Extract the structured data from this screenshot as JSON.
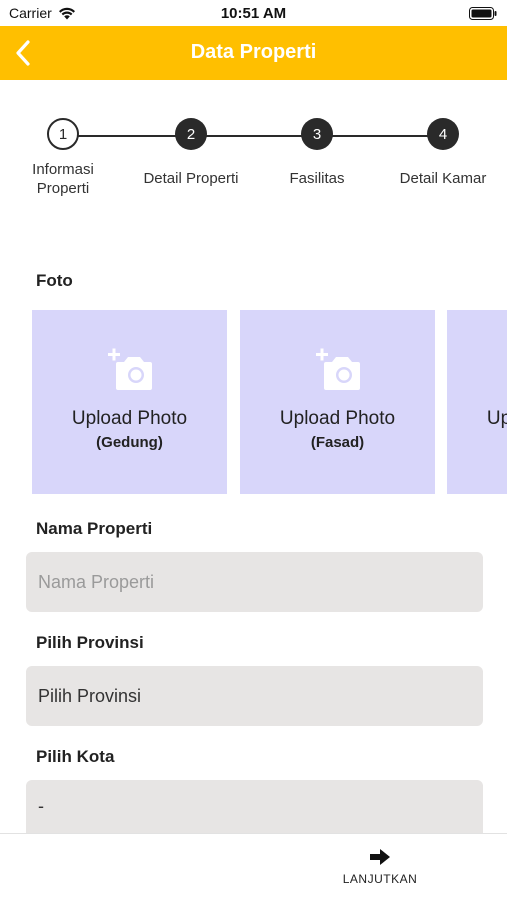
{
  "status_bar": {
    "carrier": "Carrier",
    "time": "10:51 AM"
  },
  "header": {
    "title": "Data Properti",
    "back_icon": "chevron-left-icon"
  },
  "stepper": {
    "steps": [
      {
        "number": "1",
        "label": "Informasi Properti",
        "active": true
      },
      {
        "number": "2",
        "label": "Detail Properti",
        "active": false
      },
      {
        "number": "3",
        "label": "Fasilitas",
        "active": false
      },
      {
        "number": "4",
        "label": "Detail Kamar",
        "active": false
      }
    ]
  },
  "photos": {
    "label": "Foto",
    "cards": [
      {
        "title": "Upload Photo",
        "subtitle": "(Gedung)"
      },
      {
        "title": "Upload Photo",
        "subtitle": "(Fasad)"
      },
      {
        "title": "Upload Photo",
        "subtitle": ""
      }
    ]
  },
  "form": {
    "nama_properti": {
      "label": "Nama Properti",
      "placeholder": "Nama Properti",
      "value": ""
    },
    "provinsi": {
      "label": "Pilih Provinsi",
      "value": "Pilih Provinsi"
    },
    "kota": {
      "label": "Pilih Kota",
      "value": "-"
    }
  },
  "footer": {
    "next_label": "LANJUTKAN",
    "next_icon": "arrow-right-icon"
  },
  "colors": {
    "header": "#FFBF00",
    "photo_card": "#D8D6FA",
    "field_bg": "#E7E5E4",
    "stepper": "#2a2a2a"
  }
}
